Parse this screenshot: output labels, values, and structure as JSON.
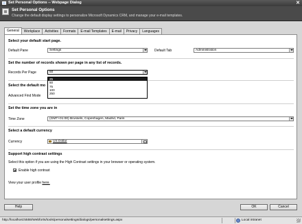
{
  "window": {
    "title": "Set Personal Options -- Webpage Dialog",
    "close_glyph": "✕"
  },
  "header": {
    "title": "Set Personal Options",
    "description": "Change the default display settings to personalize Microsoft Dynamics CRM, and manage your e-mail templates."
  },
  "tabs": [
    "General",
    "Workplace",
    "Activities",
    "Formats",
    "E-mail Templates",
    "E-mail",
    "Privacy",
    "Languages"
  ],
  "sections": {
    "start_page": {
      "heading": "Select your default start page.",
      "pane_label": "Default Pane",
      "pane_value": "Settings",
      "tab_label": "Default Tab",
      "tab_value": "Administration"
    },
    "records": {
      "heading": "Set the number of records shown per page in any list of records.",
      "label": "Records Per Page",
      "value": "50",
      "options": [
        "25",
        "50",
        "75",
        "100",
        "250"
      ],
      "selected_option": "25"
    },
    "find_mode": {
      "heading": "Select the default mo",
      "label": "Advanced Find Mode"
    },
    "timezone": {
      "heading": "Set the time zone you are in",
      "label": "Time Zone",
      "value": "(GMT+01:00) Brussels, Copenhagen, Madrid, Paris"
    },
    "currency": {
      "heading": "Select a default currency",
      "label": "Currency",
      "value": "US Dollar"
    },
    "contrast": {
      "heading": "Support high contrast settings",
      "description": "Select this option if you are using the High Contrast settings in your browser or operating system.",
      "checkbox_label": "Enable high contrast",
      "checked": true
    },
    "profile": {
      "text": "View your user profile",
      "link": "here."
    }
  },
  "buttons": {
    "help": "Help",
    "ok": "OK",
    "cancel": "Cancel"
  },
  "status": {
    "url": "http://localhost:5555/Webforts/tools/personalsettings/dialogs/personalsettings.aspx",
    "zone": "Local intranet"
  }
}
